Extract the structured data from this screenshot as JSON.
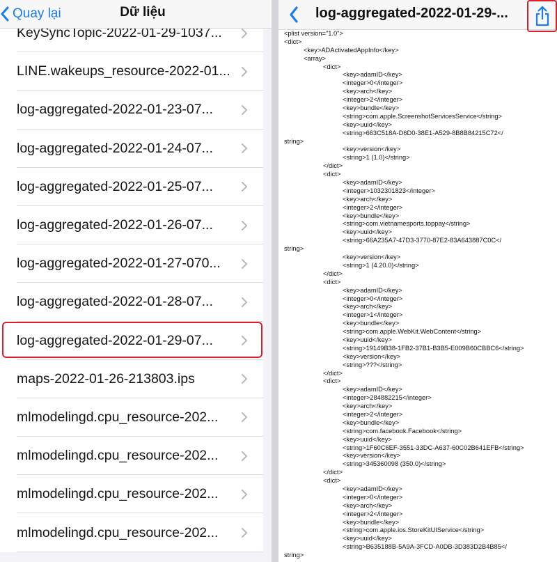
{
  "left": {
    "back_label": "Quay lại",
    "title": "Dữ liệu",
    "items": [
      {
        "label": "KeySyncTopic-2022-01-29-1037..."
      },
      {
        "label": "LINE.wakeups_resource-2022-01..."
      },
      {
        "label": "log-aggregated-2022-01-23-07..."
      },
      {
        "label": "log-aggregated-2022-01-24-07..."
      },
      {
        "label": "log-aggregated-2022-01-25-07..."
      },
      {
        "label": "log-aggregated-2022-01-26-07..."
      },
      {
        "label": "log-aggregated-2022-01-27-070..."
      },
      {
        "label": "log-aggregated-2022-01-28-07..."
      },
      {
        "label": "log-aggregated-2022-01-29-07...",
        "selected": true
      },
      {
        "label": "maps-2022-01-26-213803.ips"
      },
      {
        "label": "mlmodelingd.cpu_resource-202..."
      },
      {
        "label": "mlmodelingd.cpu_resource-202..."
      },
      {
        "label": "mlmodelingd.cpu_resource-202..."
      },
      {
        "label": "mlmodelingd.cpu_resource-202..."
      }
    ]
  },
  "right": {
    "title": "log-aggregated-2022-01-29-...",
    "share_icon": "share-icon",
    "lines": [
      {
        "indent": 0,
        "text": "<plist version=\"1.0\">"
      },
      {
        "indent": 0,
        "text": "<dict>"
      },
      {
        "indent": 1,
        "text": "<key>ADActivatedAppInfo</key>"
      },
      {
        "indent": 1,
        "text": "<array>"
      },
      {
        "indent": 2,
        "text": "<dict>"
      },
      {
        "indent": 3,
        "text": "<key>adamID</key>"
      },
      {
        "indent": 3,
        "text": "<integer>0</integer>"
      },
      {
        "indent": 3,
        "text": "<key>arch</key>"
      },
      {
        "indent": 3,
        "text": "<integer>2</integer>"
      },
      {
        "indent": 3,
        "text": "<key>bundle</key>"
      },
      {
        "indent": 3,
        "text": "<string>com.apple.ScreenshotServicesService</string>"
      },
      {
        "indent": 3,
        "text": "<key>uuid</key>"
      },
      {
        "indent": 3,
        "text": "<string>663C518A-D6D0-38E1-A529-8B8B84215C72</"
      },
      {
        "indent": 0,
        "text": "string>"
      },
      {
        "indent": 3,
        "text": "<key>version</key>"
      },
      {
        "indent": 3,
        "text": "<string>1 (1.0)</string>"
      },
      {
        "indent": 2,
        "text": "</dict>"
      },
      {
        "indent": 2,
        "text": "<dict>"
      },
      {
        "indent": 3,
        "text": "<key>adamID</key>"
      },
      {
        "indent": 3,
        "text": "<integer>1032301823</integer>"
      },
      {
        "indent": 3,
        "text": "<key>arch</key>"
      },
      {
        "indent": 3,
        "text": "<integer>2</integer>"
      },
      {
        "indent": 3,
        "text": "<key>bundle</key>"
      },
      {
        "indent": 3,
        "text": "<string>com.vietnamesports.toppay</string>"
      },
      {
        "indent": 3,
        "text": "<key>uuid</key>"
      },
      {
        "indent": 3,
        "text": "<string>66A235A7-47D3-3770-87E2-83A643887C0C</"
      },
      {
        "indent": 0,
        "text": "string>"
      },
      {
        "indent": 3,
        "text": "<key>version</key>"
      },
      {
        "indent": 3,
        "text": "<string>1 (4.20.0)</string>"
      },
      {
        "indent": 2,
        "text": "</dict>"
      },
      {
        "indent": 2,
        "text": "<dict>"
      },
      {
        "indent": 3,
        "text": "<key>adamID</key>"
      },
      {
        "indent": 3,
        "text": "<integer>0</integer>"
      },
      {
        "indent": 3,
        "text": "<key>arch</key>"
      },
      {
        "indent": 3,
        "text": "<integer>1</integer>"
      },
      {
        "indent": 3,
        "text": "<key>bundle</key>"
      },
      {
        "indent": 3,
        "text": "<string>com.apple.WebKit.WebContent</string>"
      },
      {
        "indent": 3,
        "text": "<key>uuid</key>"
      },
      {
        "indent": 3,
        "text": "<string>19149B38-1FB2-37B1-B3B5-E009B60CBBC6</string>"
      },
      {
        "indent": 3,
        "text": "<key>version</key>"
      },
      {
        "indent": 3,
        "text": "<string>???</string>"
      },
      {
        "indent": 2,
        "text": "</dict>"
      },
      {
        "indent": 2,
        "text": "<dict>"
      },
      {
        "indent": 3,
        "text": "<key>adamID</key>"
      },
      {
        "indent": 3,
        "text": "<integer>284882215</integer>"
      },
      {
        "indent": 3,
        "text": "<key>arch</key>"
      },
      {
        "indent": 3,
        "text": "<integer>2</integer>"
      },
      {
        "indent": 3,
        "text": "<key>bundle</key>"
      },
      {
        "indent": 3,
        "text": "<string>com.facebook.Facebook</string>"
      },
      {
        "indent": 3,
        "text": "<key>uuid</key>"
      },
      {
        "indent": 3,
        "text": "<string>1F60C6EF-3551-33DC-A637-60C02B641EFB</string>"
      },
      {
        "indent": 3,
        "text": "<key>version</key>"
      },
      {
        "indent": 3,
        "text": "<string>345360098 (350.0)</string>"
      },
      {
        "indent": 2,
        "text": "</dict>"
      },
      {
        "indent": 2,
        "text": "<dict>"
      },
      {
        "indent": 3,
        "text": "<key>adamID</key>"
      },
      {
        "indent": 3,
        "text": "<integer>0</integer>"
      },
      {
        "indent": 3,
        "text": "<key>arch</key>"
      },
      {
        "indent": 3,
        "text": "<integer>2</integer>"
      },
      {
        "indent": 3,
        "text": "<key>bundle</key>"
      },
      {
        "indent": 3,
        "text": "<string>com.apple.ios.StoreKitUIService</string>"
      },
      {
        "indent": 3,
        "text": "<key>uuid</key>"
      },
      {
        "indent": 3,
        "text": "<string>B635188B-5A9A-3FCD-A0DB-3D383D2B4B85</"
      },
      {
        "indent": 0,
        "text": "string>"
      }
    ]
  },
  "colors": {
    "accent": "#1a7cf2",
    "highlight": "#d9202a"
  }
}
